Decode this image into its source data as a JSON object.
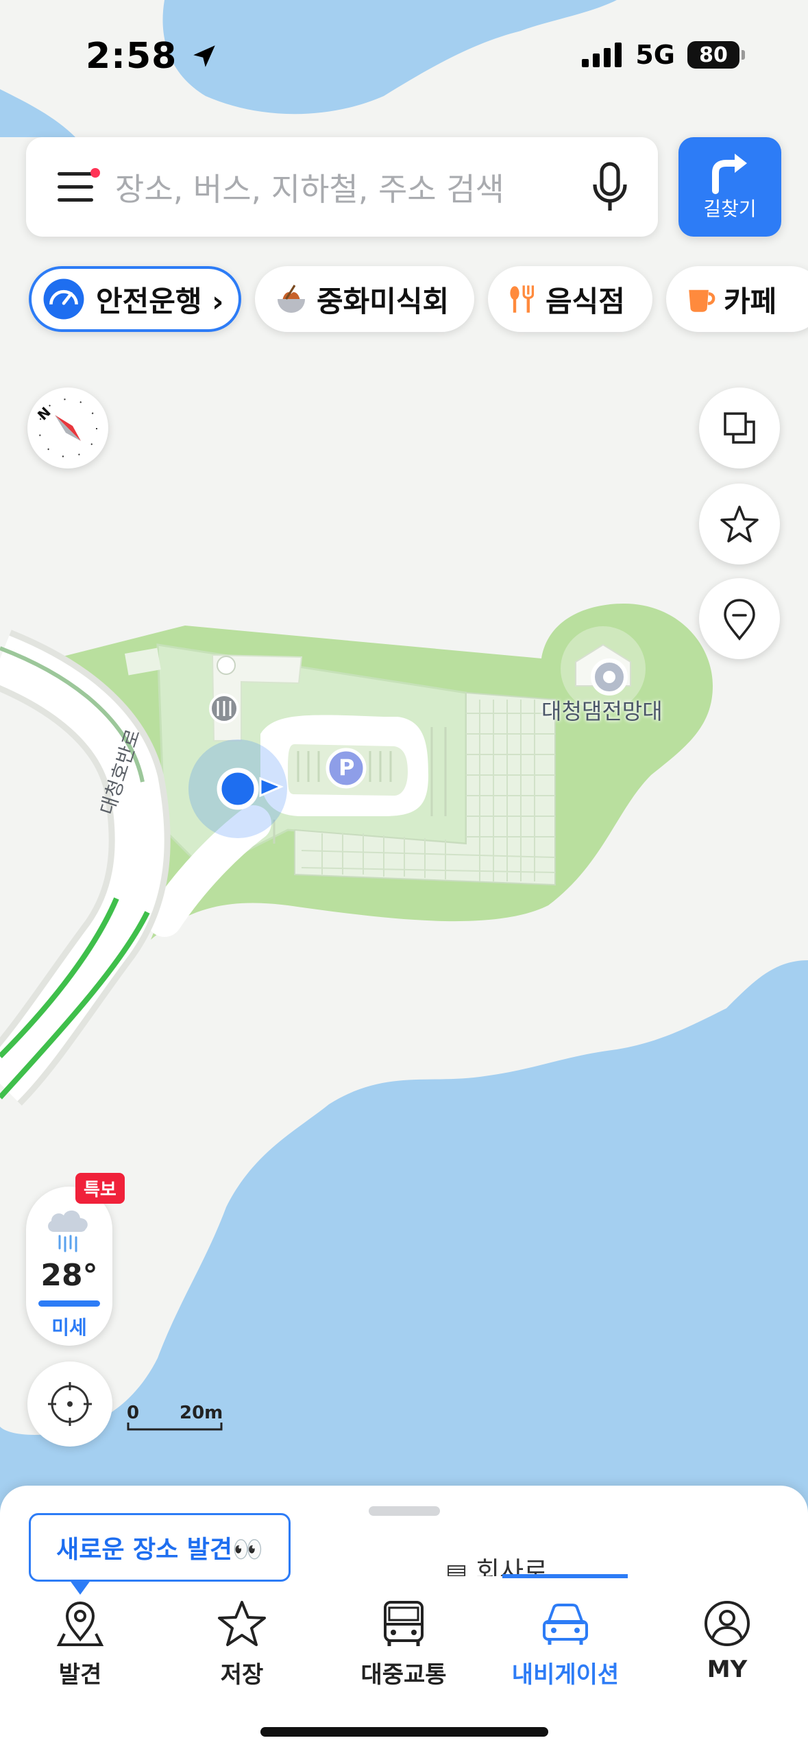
{
  "status_bar": {
    "time": "2:58",
    "network": "5G",
    "battery": "80"
  },
  "search": {
    "placeholder": "장소, 버스, 지하철, 주소 검색",
    "route_label": "길찾기"
  },
  "chips": [
    {
      "label": "안전운행 ›",
      "icon": "speedometer-icon"
    },
    {
      "label": "중화미식회",
      "icon": "noodle-bowl-icon"
    },
    {
      "label": "음식점",
      "icon": "fork-knife-icon"
    },
    {
      "label": "카페",
      "icon": "coffee-cup-icon"
    }
  ],
  "map": {
    "compass_label": "N",
    "poi_label": "대청댐전망대",
    "road_label": "대청호반로",
    "parking_label": "P",
    "colors": {
      "water": "#a4cff0",
      "land": "#f3f4f2",
      "park": "#b9df9e",
      "road_green": "#3fbf4b",
      "accent": "#2d7cf6"
    }
  },
  "weather": {
    "alert": "특보",
    "temperature": "28°",
    "dust": "미세",
    "icon": "rain-cloud-icon"
  },
  "scale": {
    "start": "0",
    "end": "20m"
  },
  "bottom_sheet": {
    "tooltip": "새로운 장소 발견👀",
    "peek_text": "회사로"
  },
  "tabs": [
    {
      "label": "발견",
      "icon": "pin-icon",
      "active": false
    },
    {
      "label": "저장",
      "icon": "star-icon",
      "active": false
    },
    {
      "label": "대중교통",
      "icon": "bus-icon",
      "active": false
    },
    {
      "label": "내비게이션",
      "icon": "car-icon",
      "active": true
    },
    {
      "label": "MY",
      "icon": "profile-icon",
      "active": false
    }
  ]
}
